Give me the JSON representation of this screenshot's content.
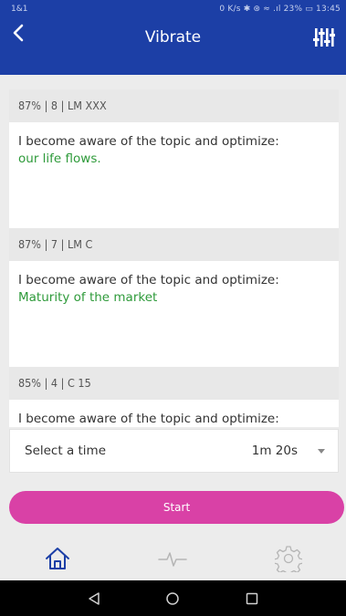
{
  "status_bar": {
    "left": "1&1",
    "right": "0 K/s ✱ ⊛ ≈ .ıl 23% ▭ 13:45"
  },
  "app_bar": {
    "title": "Vibrate",
    "back_icon": "chevron-left-icon",
    "equalizer_icon": "equalizer-icon"
  },
  "cards": [
    {
      "header": "87% | 8 | LM XXX",
      "text": "I become aware of the topic and optimize:",
      "highlight": "our life flows."
    },
    {
      "header": "87% | 7 | LM C",
      "text": "I become aware of the topic and optimize:",
      "highlight": "Maturity of the market"
    },
    {
      "header": "85% | 4 | C 15",
      "text": "I become aware of the topic and optimize:",
      "highlight": ""
    }
  ],
  "time_select": {
    "label": "Select a time",
    "value": "1m 20s"
  },
  "start_button": "Start",
  "bottom_nav": [
    "home-icon",
    "pulse-icon",
    "settings-icon"
  ],
  "colors": {
    "primary": "#1c3fa6",
    "accent": "#d941a6",
    "highlight_text": "#2e9a3a",
    "home_icon": "#1c3fa6",
    "inactive_icon": "#b5b5b5"
  }
}
